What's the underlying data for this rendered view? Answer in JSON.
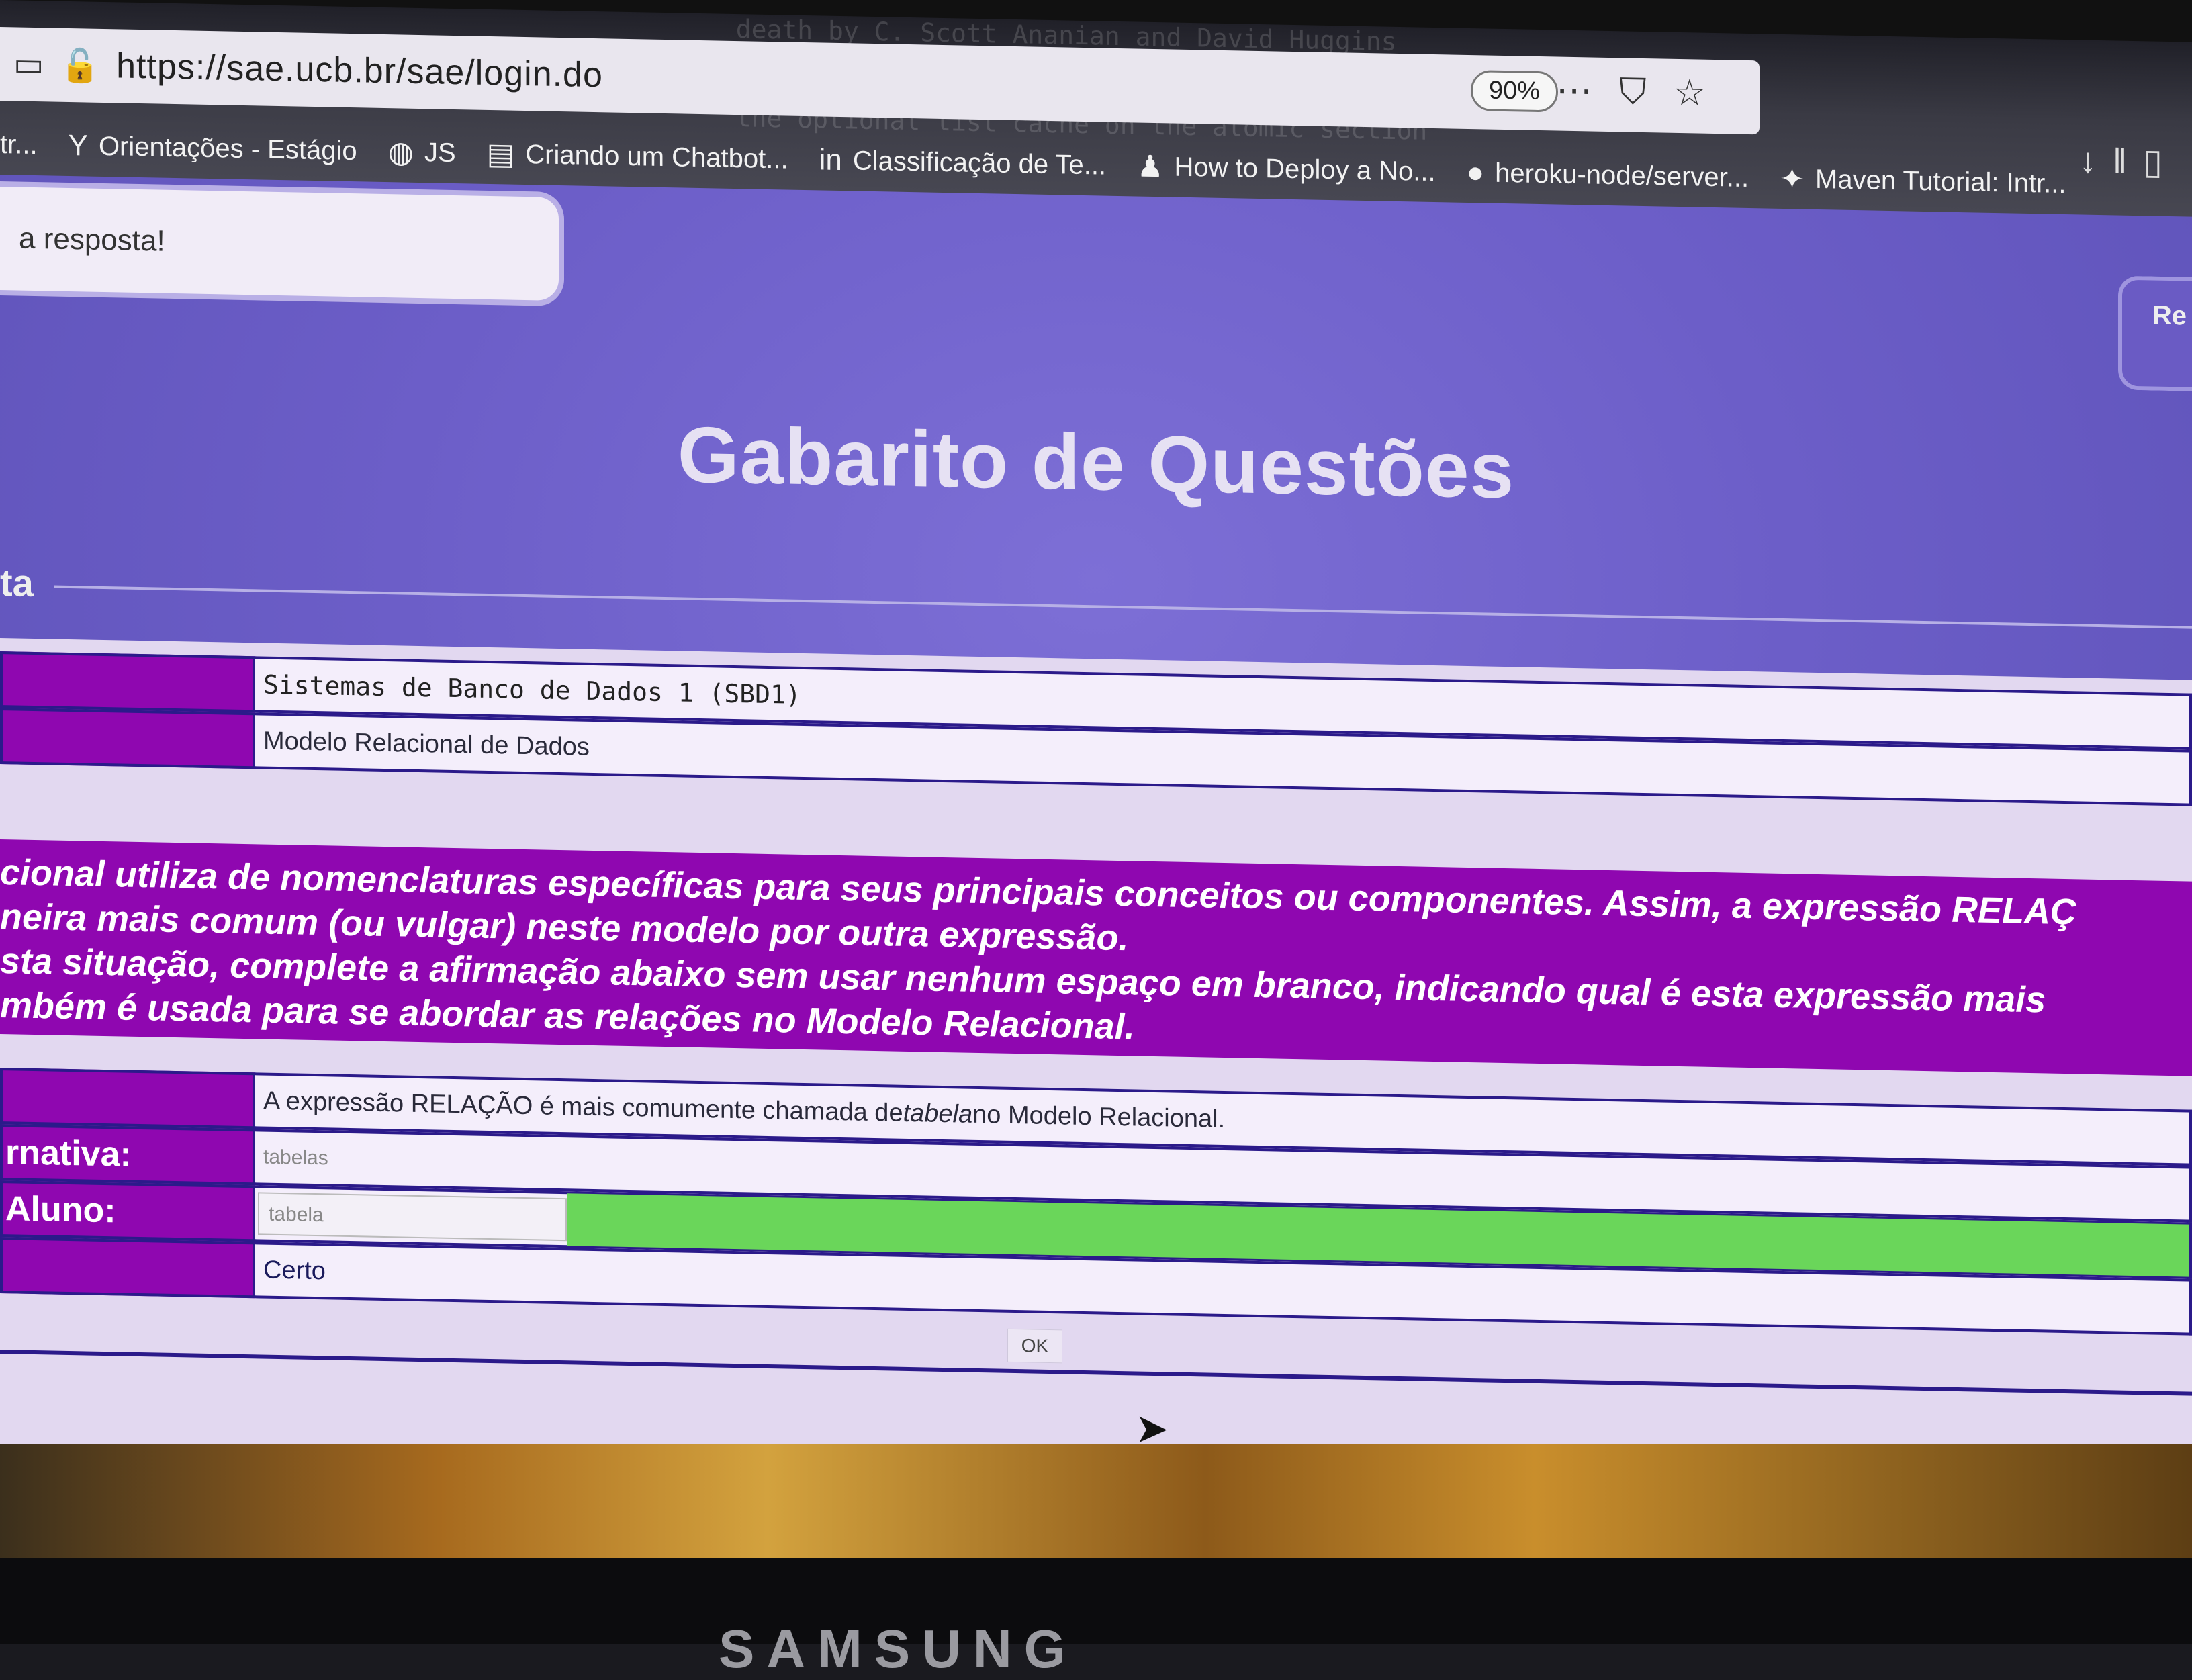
{
  "browser": {
    "url": "https://sae.ucb.br/sae/login.do",
    "zoom": "90%",
    "bookmarks": [
      {
        "label": "tr...",
        "icon": "page-icon"
      },
      {
        "label": "Orientações - Estágio",
        "icon": "y-icon"
      },
      {
        "label": "JS",
        "icon": "globe-icon"
      },
      {
        "label": "Criando um Chatbot...",
        "icon": "doc-icon"
      },
      {
        "label": "Classificação de Te...",
        "icon": "linkedin-icon"
      },
      {
        "label": "How to Deploy a No...",
        "icon": "person-icon"
      },
      {
        "label": "heroku-node/server...",
        "icon": "github-icon"
      },
      {
        "label": "Maven Tutorial: Intr...",
        "icon": "maven-icon"
      }
    ]
  },
  "page": {
    "notice": "a resposta!",
    "side_tab": "Re",
    "title": "Gabarito de Questões",
    "legend": "ta",
    "info_rows": [
      {
        "value": "Sistemas de Banco de Dados 1 (SBD1)"
      },
      {
        "value": "Modelo Relacional de Dados"
      }
    ],
    "question_lines": [
      "cional utiliza de nomenclaturas específicas para seus principais conceitos ou componentes.  Assim, a expressão RELAÇ",
      "neira mais comum (ou vulgar) neste modelo por outra expressão.",
      "sta situação, complete a afirmação abaixo sem usar nenhum espaço em branco, indicando qual é esta expressão mais",
      "mbém é usada para se abordar as relações no Modelo Relacional."
    ],
    "answer_rows": {
      "statement_pre": "A expressão RELAÇÃO é mais comumente chamada de ",
      "statement_emph": "tabela",
      "statement_post": " no Modelo Relacional.",
      "alt_label": "rnativa:",
      "alt_value": "tabelas",
      "student_label": "Aluno:",
      "student_value": "tabela",
      "result": "Certo"
    },
    "ok_button": "OK"
  },
  "monitor": {
    "brand": "SAMSUNG"
  },
  "colors": {
    "purple": "#8f07b0",
    "correct_green": "#6ad65a",
    "page_bg": "#6c5ec8"
  }
}
